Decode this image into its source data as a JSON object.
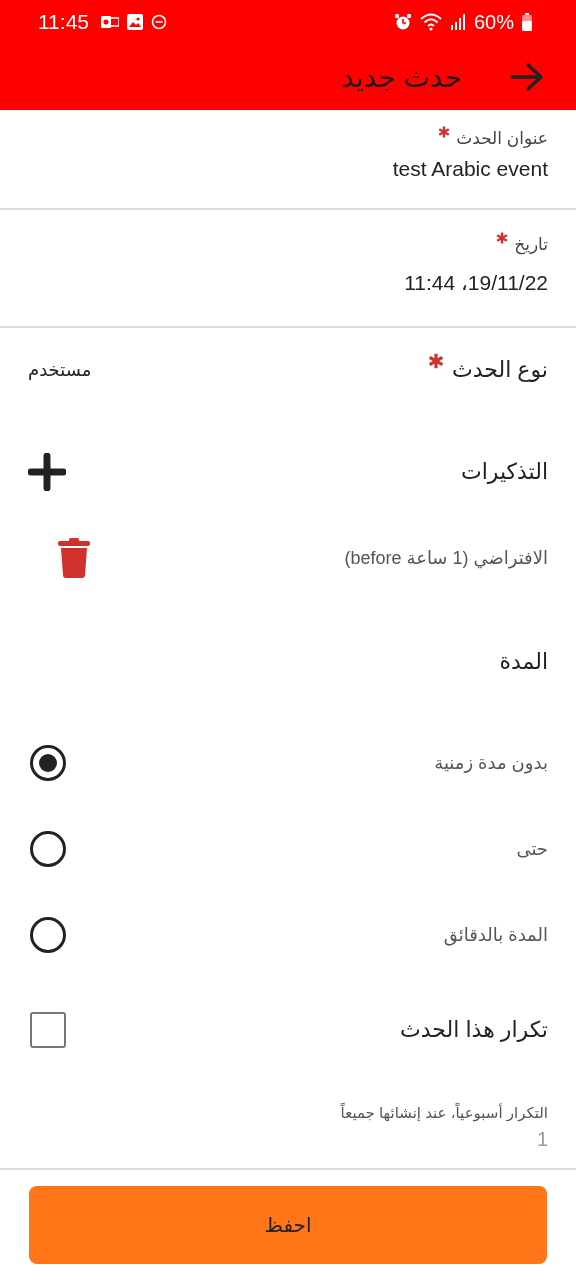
{
  "status_bar": {
    "time": "11:45",
    "battery": "60%"
  },
  "app_bar": {
    "title": "حدث جديد"
  },
  "fields": [
    {
      "label": "عنوان الحدث",
      "required": true,
      "value": "test Arabic event"
    },
    {
      "label": "تاريخ",
      "required": true,
      "value": "19/11/22، 11:44"
    }
  ],
  "event_type": {
    "label": "نوع الحدث",
    "required": true,
    "value": "مستخدم"
  },
  "reminders": {
    "label": "التذكيرات",
    "items": [
      {
        "text": "الافتراضي (1 ساعة before)"
      }
    ]
  },
  "duration": {
    "label": "المدة",
    "options": [
      {
        "label": "بدون مدة زمنية",
        "selected": true
      },
      {
        "label": "حتى",
        "selected": false
      },
      {
        "label": "المدة بالدقائق",
        "selected": false
      }
    ]
  },
  "repeat": {
    "label": "تكرار هذا الحدث",
    "checked": false
  },
  "repeat_field": {
    "label": "التكرار أسبوعياً، عند إنشائها جميعاً",
    "placeholder": "1"
  },
  "save_button": {
    "label": "احفظ"
  }
}
